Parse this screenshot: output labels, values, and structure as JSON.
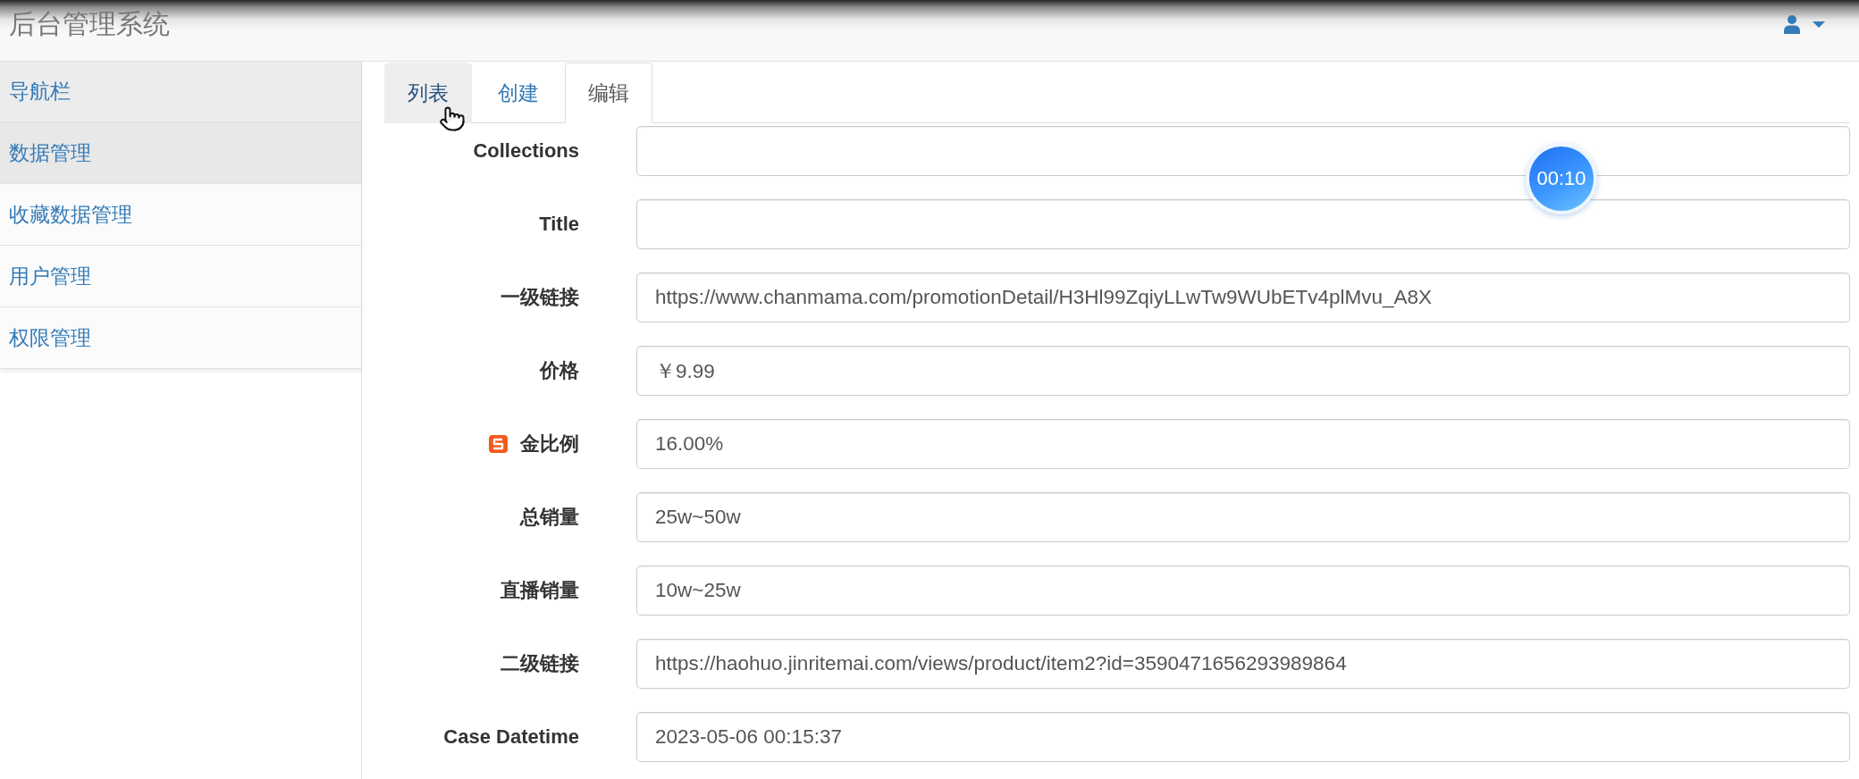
{
  "header": {
    "title": "后台管理系统"
  },
  "sidebar": {
    "heading": "导航栏",
    "items": [
      {
        "label": "数据管理",
        "selected": true
      },
      {
        "label": "收藏数据管理",
        "selected": false
      },
      {
        "label": "用户管理",
        "selected": false
      },
      {
        "label": "权限管理",
        "selected": false
      }
    ]
  },
  "tabs": [
    {
      "label": "列表",
      "selected": false,
      "hovered": true
    },
    {
      "label": "创建",
      "selected": false,
      "hovered": false
    },
    {
      "label": "编辑",
      "selected": true,
      "hovered": false
    }
  ],
  "form": {
    "fields": [
      {
        "label": "Collections"
      },
      {
        "label": "Title"
      },
      {
        "label": "一级链接",
        "value": "https://www.chanmama.com/promotionDetail/H3Hl99ZqiyLLwTw9WUbETv4plMvu_A8X"
      },
      {
        "label": "价格",
        "value": "￥9.99"
      },
      {
        "label": "金比例",
        "value": "16.00%",
        "overlay_icon": true
      },
      {
        "label": "总销量",
        "value": "25w~50w"
      },
      {
        "label": "直播销量",
        "value": "10w~25w"
      },
      {
        "label": "二级链接",
        "value": "https://haohuo.jinritemai.com/views/product/item2?id=3590471656293989864"
      },
      {
        "label": "Case Datetime",
        "value": "2023-05-06 00:15:37"
      }
    ]
  },
  "timer": {
    "text": "00:10"
  }
}
